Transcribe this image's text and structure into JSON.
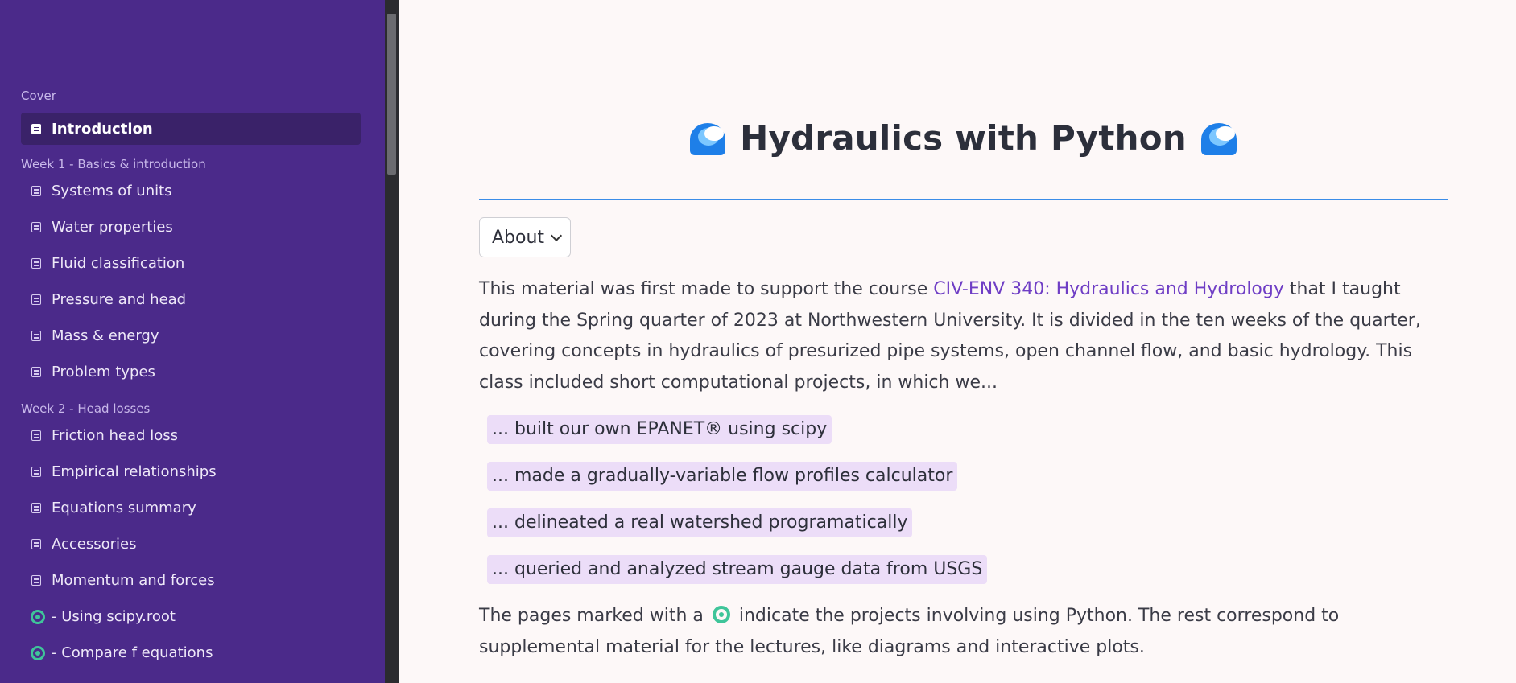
{
  "sidebar": {
    "sections": [
      {
        "title": "Cover",
        "items": [
          {
            "label": "Introduction",
            "active": true,
            "icon": "book-icon"
          }
        ]
      },
      {
        "title": "Week 1 - Basics & introduction",
        "items": [
          {
            "label": "Systems of units",
            "icon": "page-icon"
          },
          {
            "label": "Water properties",
            "icon": "page-icon"
          },
          {
            "label": "Fluid classification",
            "icon": "page-icon"
          },
          {
            "label": "Pressure and head",
            "icon": "page-icon"
          },
          {
            "label": "Mass & energy",
            "icon": "page-icon"
          },
          {
            "label": "Problem types",
            "icon": "page-icon"
          }
        ]
      },
      {
        "title": "Week 2 - Head losses",
        "items": [
          {
            "label": "Friction head loss",
            "icon": "page-icon"
          },
          {
            "label": "Empirical relationships",
            "icon": "page-icon"
          },
          {
            "label": "Equations summary",
            "icon": "page-icon"
          },
          {
            "label": "Accessories",
            "icon": "page-icon"
          },
          {
            "label": "Momentum and forces",
            "icon": "page-icon"
          },
          {
            "label": "- Using scipy.root",
            "icon": "python-project-icon"
          },
          {
            "label": "- Compare f equations",
            "icon": "python-project-icon"
          }
        ]
      }
    ]
  },
  "main": {
    "title": "Hydraulics with Python",
    "about_label": "About",
    "intro_before_link": "This material was first made to support the course ",
    "intro_link": "CIV-ENV 340: Hydraulics and Hydrology",
    "intro_after_link": " that I taught during the Spring quarter of 2023 at Northwestern University. It is divided in the ten weeks of the quarter, covering concepts in hydraulics of presurized pipe systems, open channel flow, and basic hydrology. This class included short computational projects, in which we...",
    "projects": [
      "... built our own EPANET® using scipy",
      "... made a gradually-variable flow profiles calculator",
      "... delineated a real watershed programatically",
      "... queried and analyzed stream gauge data from USGS"
    ],
    "footer_before_icon": "The pages marked with a ",
    "footer_after_icon": " indicate the projects involving using Python. The rest correspond to supplemental material for the lectures, like diagrams and interactive plots."
  },
  "colors": {
    "sidebar_bg": "#4b2a8a",
    "active_item_bg": "#3a2269",
    "link": "#6f3ec5",
    "rule": "#3b8de8",
    "chip_bg": "#ecddf8",
    "python_icon": "#3fc59a"
  }
}
